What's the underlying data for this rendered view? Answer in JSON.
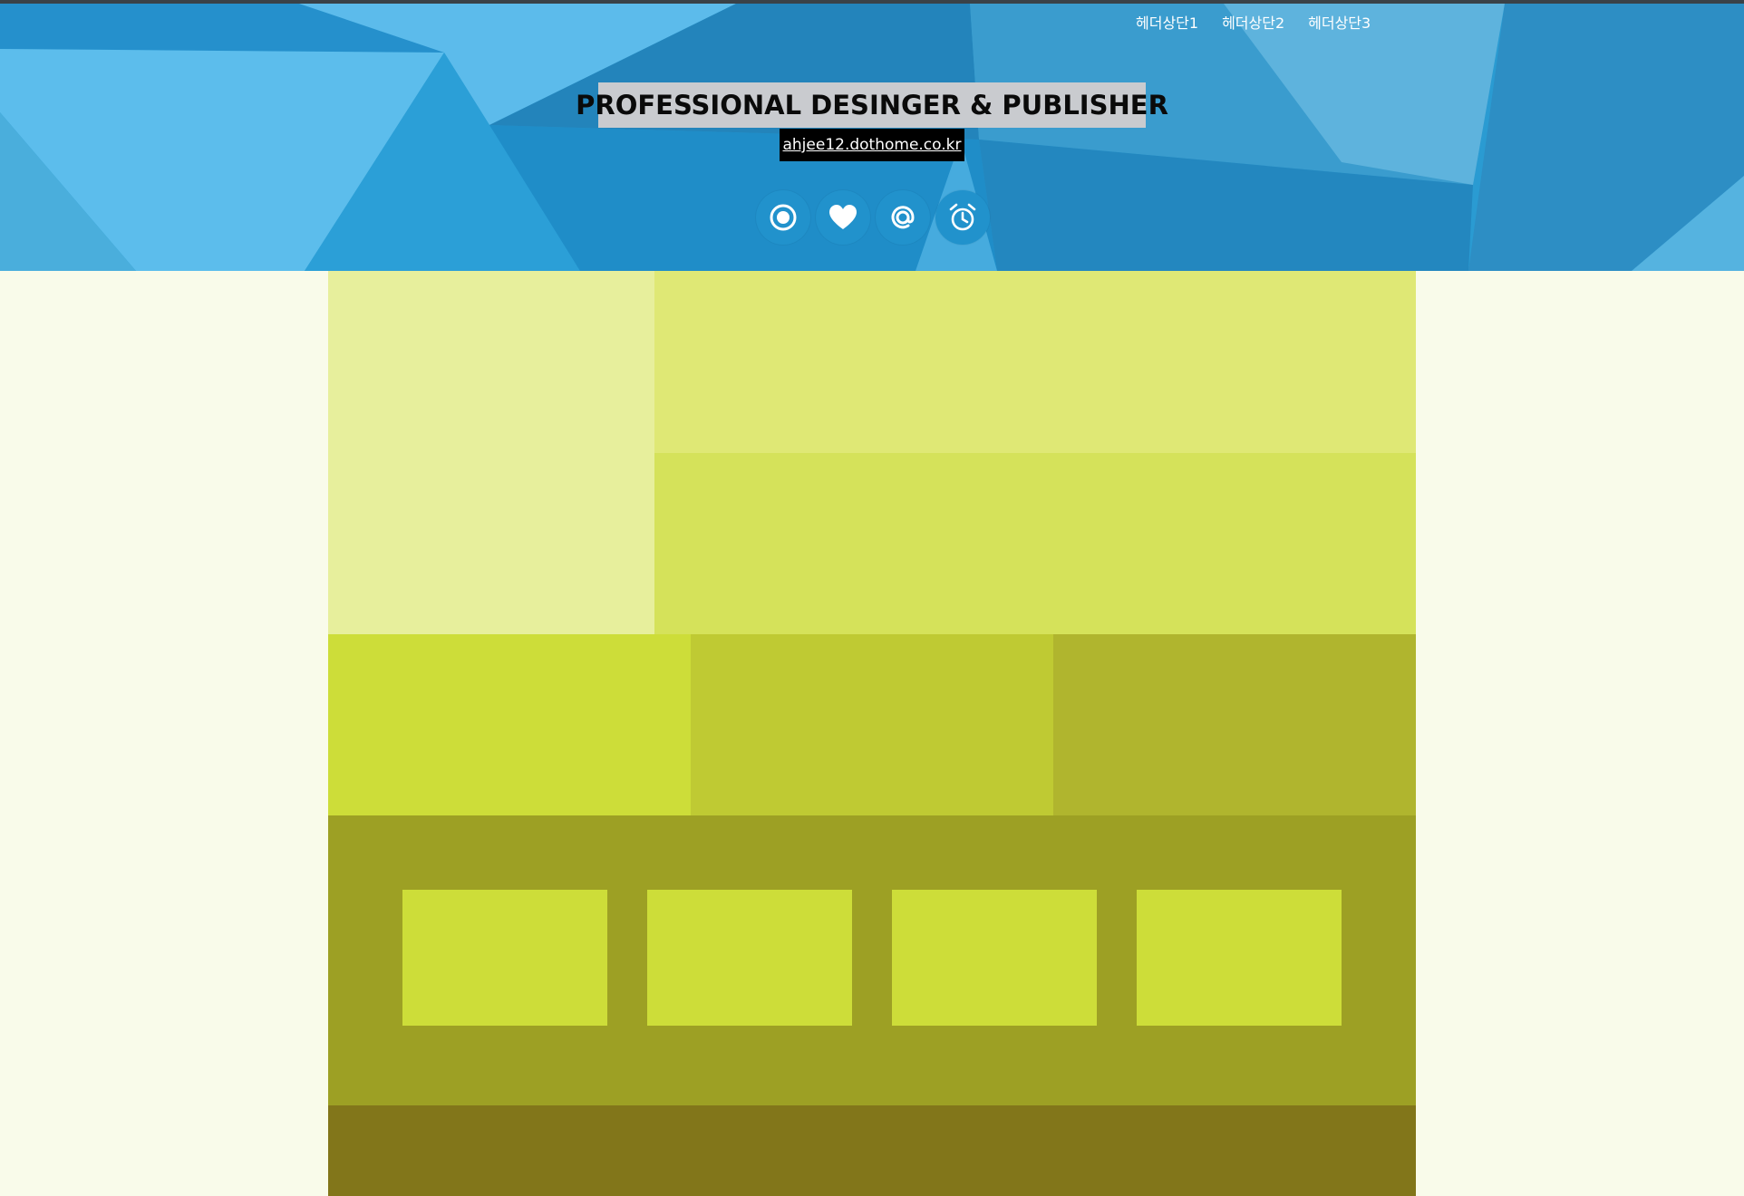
{
  "header": {
    "nav": [
      "헤더상단1",
      "헤더상단2",
      "헤더상단3"
    ],
    "title": "PROFESSIONAL DESINGER & PUBLISHER",
    "link": "ahjee12.dothome.co.kr",
    "icons": [
      "target-icon",
      "heart-icon",
      "at-icon",
      "alarm-clock-icon"
    ]
  },
  "colors": {
    "page_bg": "#f9fbea",
    "header_blue": "#2a9bd2",
    "block_light": "#e7ef9c",
    "block_top_right": "#dfe875",
    "block_mid_right": "#d5e25a",
    "block_row_a": "#cddd39",
    "block_row_b": "#bfca33",
    "block_row_c": "#b0b52e",
    "band": "#9da024",
    "footer": "#82761a"
  }
}
